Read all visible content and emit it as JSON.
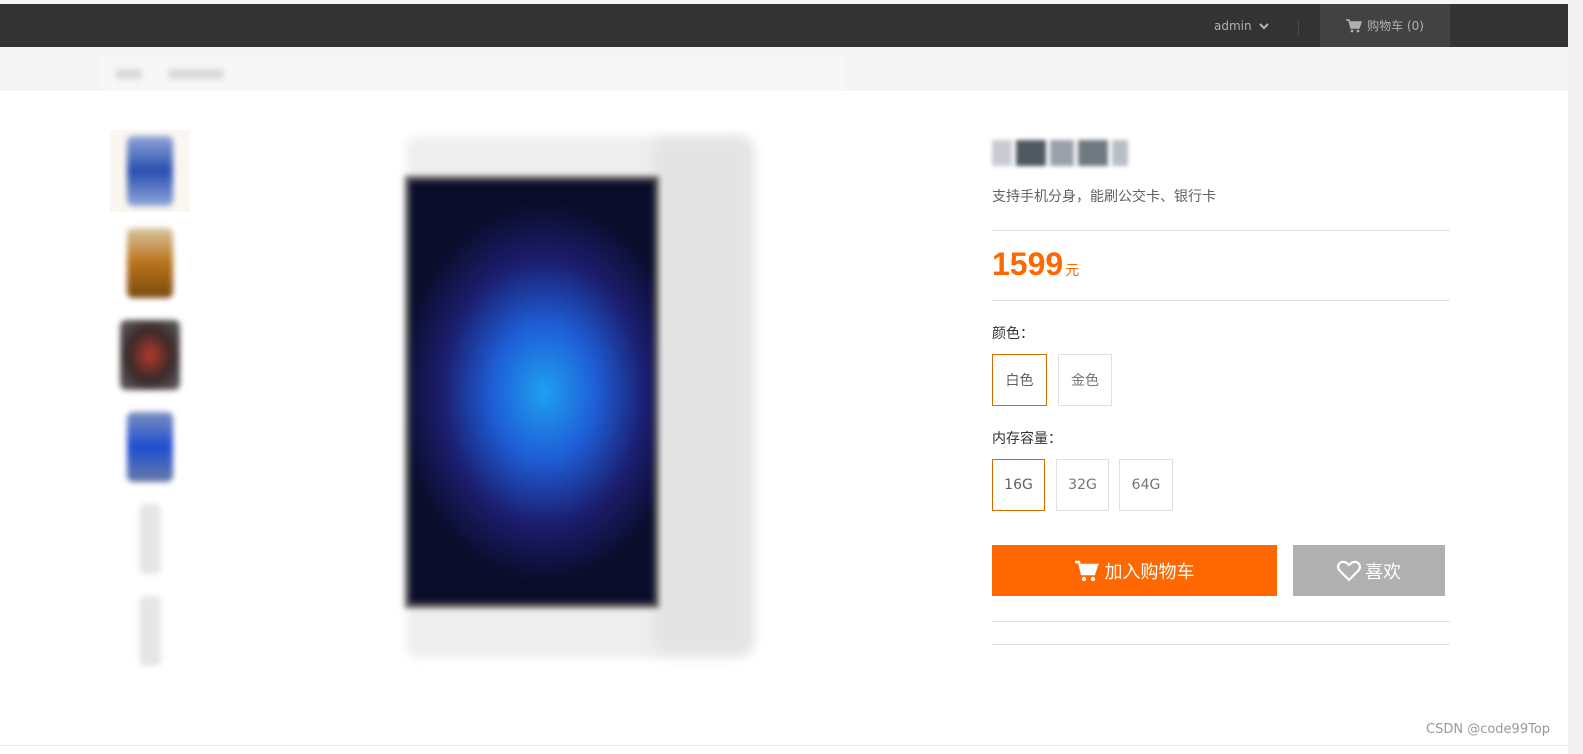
{
  "header": {
    "username": "admin",
    "cart_label": "购物车 (0)",
    "colors": {
      "bar": "#333333",
      "cart_bg": "#424242",
      "text": "#b0b0b0"
    }
  },
  "product": {
    "subtitle": "支持手机分身，能刷公交卡、银行卡",
    "price": "1599",
    "price_unit": "元",
    "color_label": "颜色：",
    "color_options": [
      "白色",
      "金色"
    ],
    "selected_color": "白色",
    "memory_label": "内存容量：",
    "memory_options": [
      "16G",
      "32G",
      "64G"
    ],
    "selected_memory": "16G",
    "add_to_cart_label": "加入购物车",
    "like_label": "喜欢",
    "accent_color": "#ff6700"
  },
  "gallery": {
    "thumbnails": [
      {
        "icon": "phone-blue-thumbnail",
        "active": true
      },
      {
        "icon": "phone-gold-thumbnail",
        "active": false
      },
      {
        "icon": "phone-red-thumbnail",
        "active": false
      },
      {
        "icon": "phone-blue2-thumbnail",
        "active": false
      },
      {
        "icon": "phone-white-thumbnail",
        "active": false
      },
      {
        "icon": "phone-white2-thumbnail",
        "active": false
      }
    ]
  },
  "watermark": "CSDN @code99Top"
}
